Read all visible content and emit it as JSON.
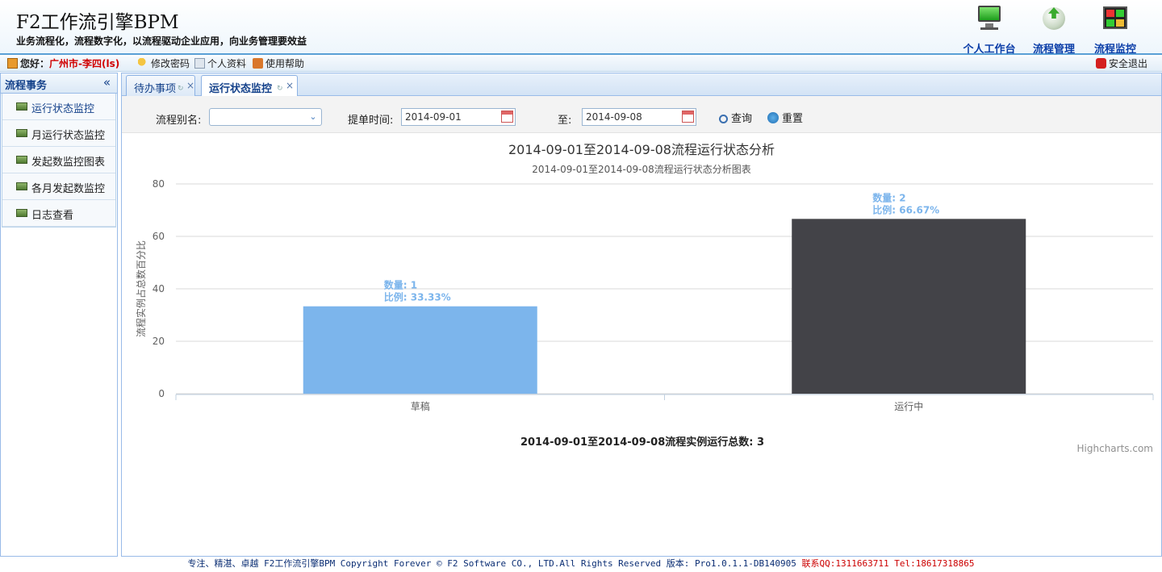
{
  "header": {
    "title": "F2工作流引擎BPM",
    "slogan": "业务流程化，流程数字化，以流程驱动企业应用，向业务管理要效益",
    "nav": {
      "workbench": "个人工作台",
      "flow_management": "流程管理",
      "flow_monitor": "流程监控"
    }
  },
  "userbar": {
    "greeting": "您好：",
    "user": "广州市-李四(ls)",
    "change_password": "修改密码",
    "profile": "个人资料",
    "help": "使用帮助",
    "logout": "安全退出"
  },
  "sidebar": {
    "title": "流程事务",
    "items": [
      {
        "label": "运行状态监控"
      },
      {
        "label": "月运行状态监控"
      },
      {
        "label": "发起数监控图表"
      },
      {
        "label": "各月发起数监控"
      },
      {
        "label": "日志查看"
      }
    ]
  },
  "tabs": [
    {
      "label": "待办事项"
    },
    {
      "label": "运行状态监控"
    }
  ],
  "filter": {
    "flow_alias_label": "流程别名:",
    "flow_alias_value": "",
    "submit_time_label": "提单时间:",
    "date_from": "2014-09-01",
    "to_label": "至:",
    "date_to": "2014-09-08",
    "query_button": "查询",
    "reset_button": "重置"
  },
  "chart_data": {
    "type": "bar",
    "title": "2014-09-01至2014-09-08流程运行状态分析",
    "subtitle": "2014-09-01至2014-09-08流程运行状态分析图表",
    "ylabel": "流程实例占总数百分比",
    "xlabel": "",
    "categories": [
      "草稿",
      "运行中"
    ],
    "values": [
      33.33,
      66.67
    ],
    "data_labels": [
      {
        "count": "数量: 1",
        "ratio": "比例: 33.33%"
      },
      {
        "count": "数量: 2",
        "ratio": "比例: 66.67%"
      }
    ],
    "colors": [
      "#7cb5ec",
      "#434348"
    ],
    "ylim": [
      0,
      80
    ],
    "yticks": [
      0,
      20,
      40,
      60,
      80
    ],
    "grid": true,
    "legend": "none"
  },
  "total_line": "2014-09-01至2014-09-08流程实例运行总数: 3",
  "credits": "Highcharts.com",
  "footer": {
    "text": "专注、精湛、卓越 F2工作流引擎BPM Copyright Forever © F2 Software CO., LTD.All Rights Reserved 版本: Pro1.0.1.1-DB140905 ",
    "contact": "联系QQ:1311663711 Tel:18617318865"
  }
}
